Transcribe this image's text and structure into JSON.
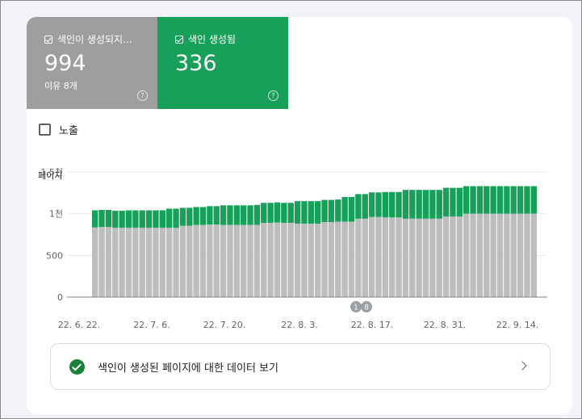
{
  "tiles": {
    "not_indexed": {
      "label": "색인이 생성되지...",
      "value": "994",
      "sub": "이유 8개"
    },
    "indexed": {
      "label": "색인 생성됨",
      "value": "336"
    }
  },
  "help_glyph": "?",
  "impressions_label": "노출",
  "link_text": "색인이 생성된 페이지에 대한 데이터 보기",
  "colors": {
    "indexed": "#17a05a",
    "not_indexed": "#bdbdbd",
    "tile_gray": "#9e9e9e"
  },
  "chart_data": {
    "type": "bar",
    "stacked": true,
    "ylabel": "페이지",
    "yticks": [
      "1.5천",
      "1천",
      "500",
      "0"
    ],
    "ytick_values": [
      1500,
      1000,
      500,
      0
    ],
    "ylim": [
      0,
      1500
    ],
    "grid": true,
    "xtick_labels": [
      "22. 6. 22.",
      "22. 7. 6.",
      "22. 7. 20.",
      "22. 8. 3.",
      "22. 8. 17.",
      "22. 8. 31.",
      "22. 9. 14."
    ],
    "annotations": [
      "1",
      "8"
    ],
    "series": [
      {
        "name": "색인이 생성되지 않음",
        "color": "#bdbdbd",
        "values": [
          835,
          840,
          840,
          830,
          830,
          830,
          830,
          830,
          830,
          830,
          830,
          830,
          830,
          855,
          855,
          865,
          865,
          870,
          870,
          865,
          865,
          865,
          865,
          865,
          865,
          890,
          890,
          895,
          890,
          890,
          880,
          880,
          880,
          880,
          900,
          900,
          905,
          905,
          905,
          940,
          940,
          960,
          960,
          955,
          955,
          955,
          940,
          940,
          940,
          940,
          940,
          940,
          965,
          965,
          965,
          1000,
          1000,
          1000,
          1000,
          1000,
          1000,
          1000,
          1000,
          1000,
          1000,
          1000
        ]
      },
      {
        "name": "색인 생성됨",
        "color": "#17a05a",
        "values": [
          205,
          205,
          205,
          205,
          205,
          210,
          210,
          210,
          210,
          210,
          210,
          230,
          230,
          215,
          215,
          215,
          215,
          220,
          220,
          235,
          235,
          235,
          235,
          235,
          240,
          240,
          240,
          240,
          240,
          240,
          270,
          270,
          270,
          270,
          265,
          265,
          265,
          295,
          295,
          295,
          295,
          295,
          295,
          305,
          305,
          305,
          345,
          345,
          345,
          345,
          345,
          345,
          345,
          345,
          345,
          330,
          330,
          330,
          330,
          330,
          330,
          330,
          330,
          330,
          330,
          330
        ]
      }
    ]
  }
}
